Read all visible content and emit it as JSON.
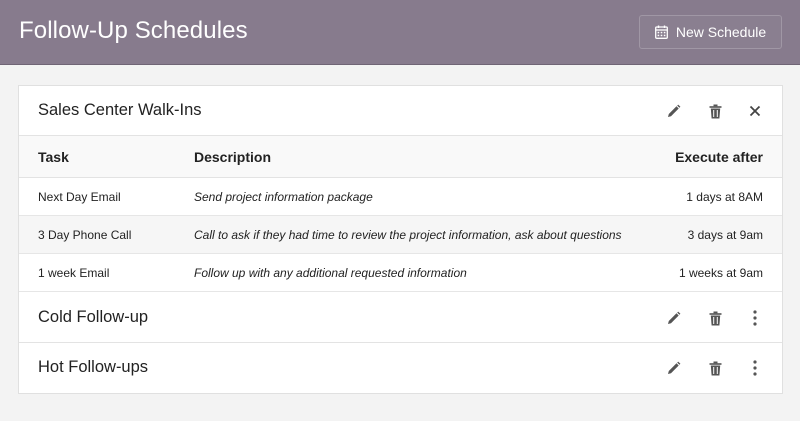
{
  "header": {
    "title": "Follow-Up Schedules",
    "new_button_label": "New Schedule"
  },
  "schedules": [
    {
      "name": "Sales Center Walk-Ins",
      "expanded": true,
      "columns": {
        "task": "Task",
        "description": "Description",
        "execute_after": "Execute after"
      },
      "rows": [
        {
          "task": "Next Day Email",
          "description": "Send project information package",
          "execute_after": "1 days at 8AM"
        },
        {
          "task": "3 Day Phone Call",
          "description": "Call to ask if they had time to review the project information, ask about questions",
          "execute_after": "3 days at 9am"
        },
        {
          "task": "1 week Email",
          "description": "Follow up with any additional requested information",
          "execute_after": "1 weeks at 9am"
        }
      ]
    },
    {
      "name": "Cold Follow-up",
      "expanded": false
    },
    {
      "name": "Hot Follow-ups",
      "expanded": false
    }
  ],
  "icons": {
    "new_schedule": "calendar-icon",
    "edit": "pencil-icon",
    "delete": "trash-icon",
    "close": "close-icon",
    "more": "more-vertical-icon"
  },
  "colors": {
    "header_bg": "#877b8d",
    "header_text": "#ffffff",
    "icon": "#555555",
    "page_bg": "#f3f3f3"
  }
}
